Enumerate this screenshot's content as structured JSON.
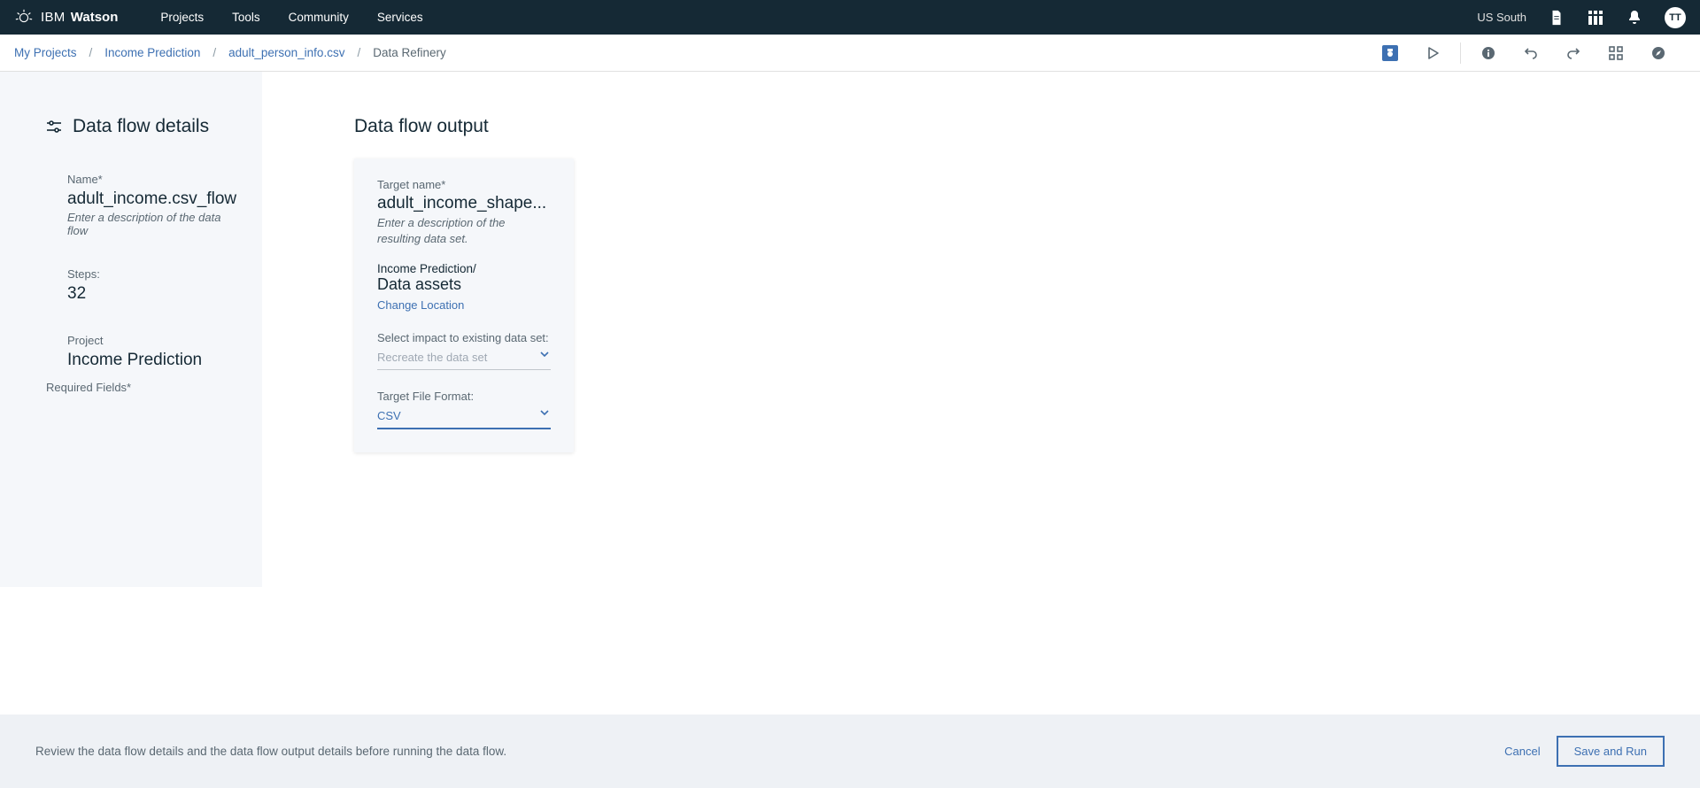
{
  "header": {
    "brand_ibm": "IBM",
    "brand_watson": "Watson",
    "nav": [
      "Projects",
      "Tools",
      "Community",
      "Services"
    ],
    "region": "US South",
    "avatar_initials": "TT"
  },
  "breadcrumbs": {
    "items": [
      {
        "label": "My Projects",
        "link": true
      },
      {
        "label": "Income Prediction",
        "link": true
      },
      {
        "label": "adult_person_info.csv",
        "link": true
      },
      {
        "label": "Data Refinery",
        "link": false
      }
    ],
    "sep": "/"
  },
  "sidebar": {
    "title": "Data flow details",
    "name_label": "Name*",
    "name_value": "adult_income.csv_flow",
    "name_desc": "Enter a description of the data flow",
    "steps_label": "Steps:",
    "steps_value": "32",
    "project_label": "Project",
    "project_value": "Income Prediction",
    "required": "Required Fields*"
  },
  "output": {
    "title": "Data flow output",
    "target_name_label": "Target name*",
    "target_name_value": "adult_income_shape...",
    "target_desc": "Enter a description of the resulting data set.",
    "path": "Income Prediction/",
    "assets": "Data assets",
    "change_location": "Change Location",
    "impact_label": "Select impact to existing data set:",
    "impact_value": "Recreate the data set",
    "format_label": "Target File Format:",
    "format_value": "CSV"
  },
  "footer": {
    "message": "Review the data flow details and the data flow output details before running the data flow.",
    "cancel": "Cancel",
    "save_run": "Save and Run"
  }
}
